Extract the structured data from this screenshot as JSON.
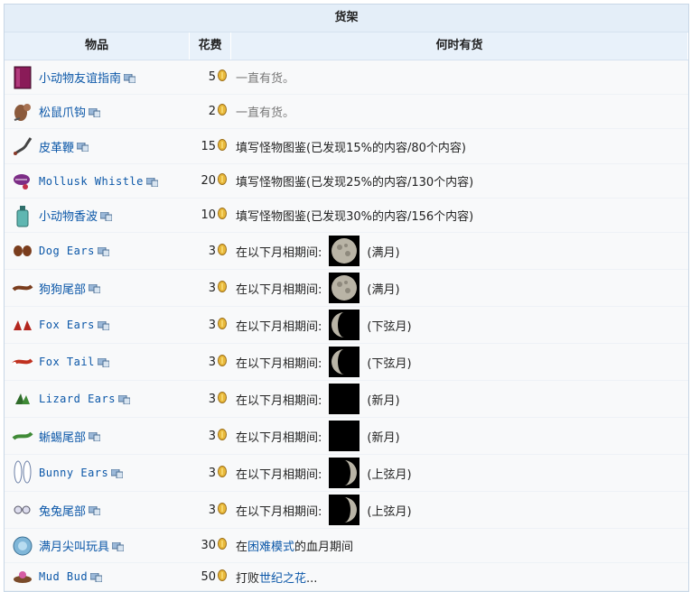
{
  "table": {
    "caption": "货架",
    "headers": {
      "item": "物品",
      "cost": "花费",
      "availability": "何时有货"
    }
  },
  "rows": [
    {
      "name": "小动物友谊指南",
      "mono": false,
      "icon": "book-icon",
      "cost": "5",
      "avail": {
        "type": "text",
        "text": "一直有货。",
        "gray": true
      }
    },
    {
      "name": "松鼠爪钩",
      "mono": false,
      "icon": "squirrel-hook-icon",
      "cost": "2",
      "avail": {
        "type": "text",
        "text": "一直有货。",
        "gray": true
      }
    },
    {
      "name": "皮革鞭",
      "mono": false,
      "icon": "leather-whip-icon",
      "cost": "15",
      "avail": {
        "type": "text",
        "text": "填写怪物图鉴(已发现15%的内容/80个内容)"
      }
    },
    {
      "name": "Mollusk Whistle",
      "mono": true,
      "icon": "mollusk-whistle-icon",
      "cost": "20",
      "avail": {
        "type": "text",
        "text": "填写怪物图鉴(已发现25%的内容/130个内容)"
      }
    },
    {
      "name": "小动物香波",
      "mono": false,
      "icon": "shampoo-icon",
      "cost": "10",
      "avail": {
        "type": "text",
        "text": "填写怪物图鉴(已发现30%的内容/156个内容)"
      }
    },
    {
      "name": "Dog Ears",
      "mono": true,
      "icon": "dog-ears-icon",
      "cost": "3",
      "avail": {
        "type": "moon",
        "prefix": "在以下月相期间:",
        "phase": "full",
        "label": "(满月)"
      }
    },
    {
      "name": "狗狗尾部",
      "mono": false,
      "icon": "dog-tail-icon",
      "cost": "3",
      "avail": {
        "type": "moon",
        "prefix": "在以下月相期间:",
        "phase": "full",
        "label": "(满月)"
      }
    },
    {
      "name": "Fox Ears",
      "mono": true,
      "icon": "fox-ears-icon",
      "cost": "3",
      "avail": {
        "type": "moon",
        "prefix": "在以下月相期间:",
        "phase": "third",
        "label": "(下弦月)"
      }
    },
    {
      "name": "Fox Tail",
      "mono": true,
      "icon": "fox-tail-icon",
      "cost": "3",
      "avail": {
        "type": "moon",
        "prefix": "在以下月相期间:",
        "phase": "third",
        "label": "(下弦月)"
      }
    },
    {
      "name": "Lizard Ears",
      "mono": true,
      "icon": "lizard-ears-icon",
      "cost": "3",
      "avail": {
        "type": "moon",
        "prefix": "在以下月相期间:",
        "phase": "new",
        "label": "(新月)"
      }
    },
    {
      "name": "蜥蜴尾部",
      "mono": false,
      "icon": "lizard-tail-icon",
      "cost": "3",
      "avail": {
        "type": "moon",
        "prefix": "在以下月相期间:",
        "phase": "new",
        "label": "(新月)"
      }
    },
    {
      "name": "Bunny Ears",
      "mono": true,
      "icon": "bunny-ears-icon",
      "cost": "3",
      "avail": {
        "type": "moon",
        "prefix": "在以下月相期间:",
        "phase": "first",
        "label": "(上弦月)"
      }
    },
    {
      "name": "兔兔尾部",
      "mono": false,
      "icon": "bunny-tail-icon",
      "cost": "3",
      "avail": {
        "type": "moon",
        "prefix": "在以下月相期间:",
        "phase": "first",
        "label": "(上弦月)"
      }
    },
    {
      "name": "满月尖叫玩具",
      "mono": false,
      "icon": "squeaky-toy-icon",
      "cost": "30",
      "avail": {
        "type": "link",
        "before": "在",
        "link": "困难模式",
        "after": "的血月期间"
      }
    },
    {
      "name": "Mud Bud",
      "mono": true,
      "icon": "mud-bud-icon",
      "cost": "50",
      "avail": {
        "type": "link",
        "before": "打败",
        "link": "世纪之花",
        "after": "..."
      }
    }
  ],
  "colors": {
    "header_bg": "#e4eef8",
    "link": "#0b57a8",
    "coin": "#e8b83a"
  }
}
